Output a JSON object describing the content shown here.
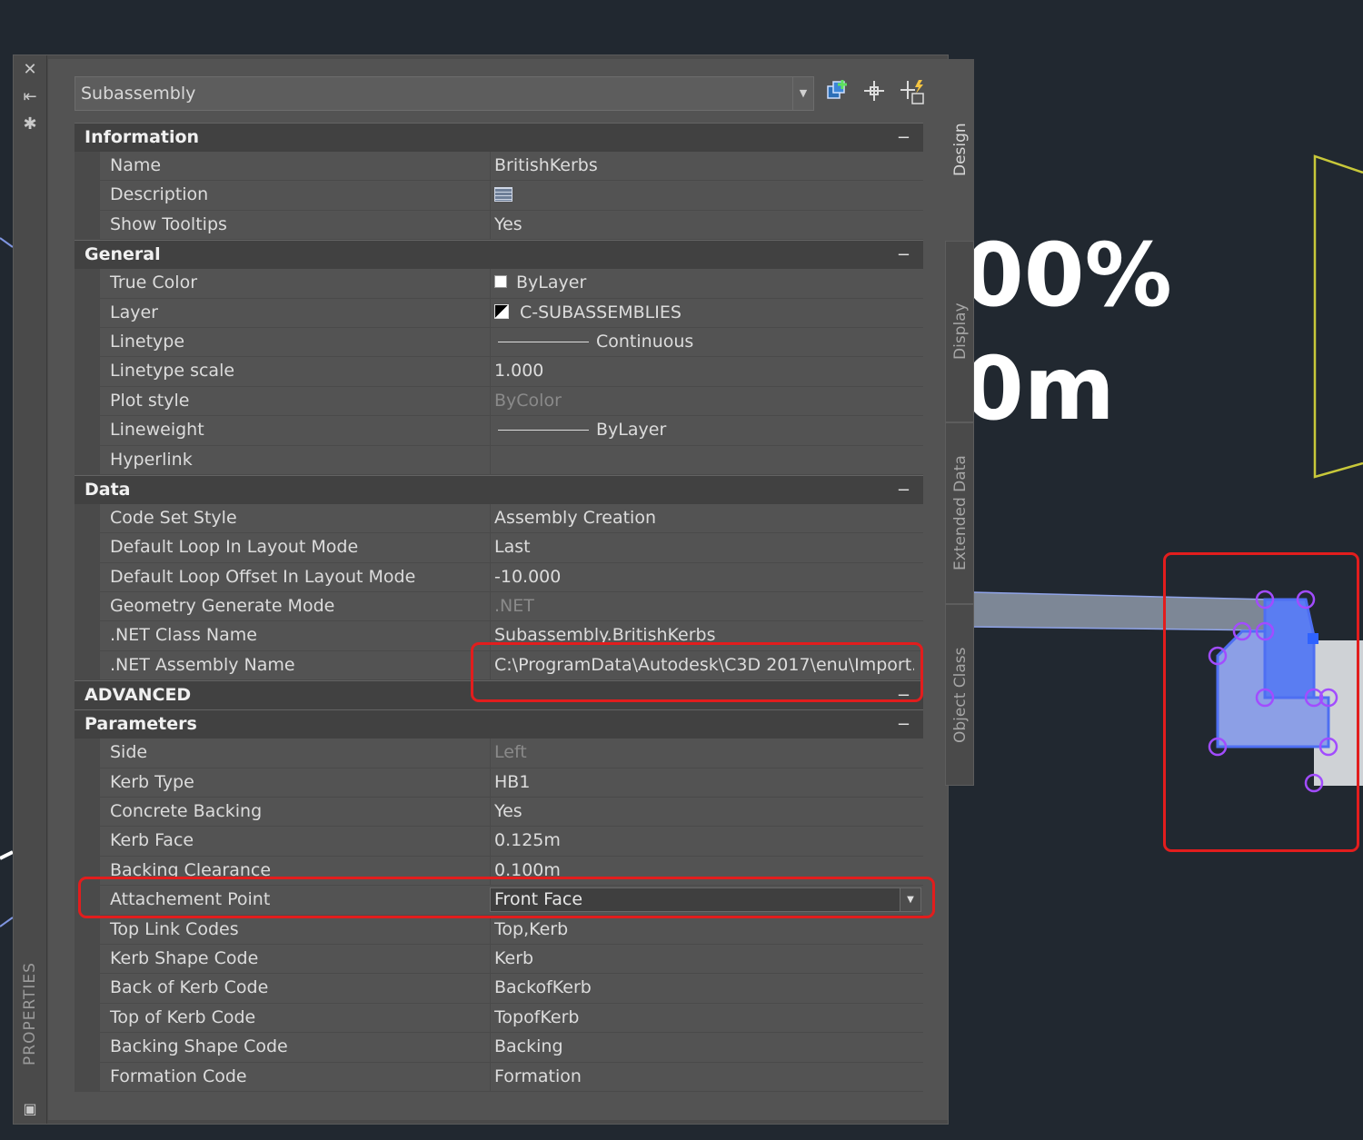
{
  "canvas": {
    "percent_text": "00%",
    "length_text": "0m"
  },
  "palette": {
    "title": "PROPERTIES",
    "selector": {
      "value": "Subassembly"
    },
    "tabs": [
      "Design",
      "Display",
      "Extended Data",
      "Object Class"
    ]
  },
  "information": {
    "title": "Information",
    "toggle": "−",
    "rows": [
      {
        "label": "Name",
        "value": "BritishKerbs"
      },
      {
        "label": "Description",
        "value": ""
      },
      {
        "label": "Show Tooltips",
        "value": "Yes"
      }
    ]
  },
  "general": {
    "title": "General",
    "toggle": "−",
    "rows": [
      {
        "label": "True Color",
        "value": "ByLayer"
      },
      {
        "label": "Layer",
        "value": "C-SUBASSEMBLIES"
      },
      {
        "label": "Linetype",
        "value": "Continuous"
      },
      {
        "label": "Linetype scale",
        "value": "1.000"
      },
      {
        "label": "Plot style",
        "value": "ByColor"
      },
      {
        "label": "Lineweight",
        "value": "ByLayer"
      },
      {
        "label": "Hyperlink",
        "value": ""
      }
    ]
  },
  "data_section": {
    "title": "Data",
    "toggle": "−",
    "rows": [
      {
        "label": "Code Set Style",
        "value": "Assembly Creation"
      },
      {
        "label": "Default Loop In Layout Mode",
        "value": "Last"
      },
      {
        "label": "Default Loop Offset In Layout Mode",
        "value": "-10.000"
      },
      {
        "label": "Geometry Generate Mode",
        "value": ".NET"
      },
      {
        "label": ".NET Class Name",
        "value": "Subassembly.BritishKerbs"
      },
      {
        "label": ".NET Assembly Name",
        "value": "C:\\ProgramData\\Autodesk\\C3D  2017\\enu\\Import..."
      }
    ]
  },
  "advanced": {
    "title": "ADVANCED",
    "toggle": "−"
  },
  "parameters": {
    "title": "Parameters",
    "toggle": "−",
    "rows": [
      {
        "label": "Side",
        "value": "Left"
      },
      {
        "label": "Kerb Type",
        "value": "HB1"
      },
      {
        "label": "Concrete Backing",
        "value": "Yes"
      },
      {
        "label": "Kerb Face",
        "value": "0.125m"
      },
      {
        "label": "Backing Clearance",
        "value": "0.100m"
      },
      {
        "label": "Attachement Point",
        "value": "Front Face"
      },
      {
        "label": "Top Link Codes",
        "value": "Top,Kerb"
      },
      {
        "label": "Kerb Shape Code",
        "value": "Kerb"
      },
      {
        "label": "Back of Kerb Code",
        "value": "BackofKerb"
      },
      {
        "label": "Top of Kerb Code",
        "value": "TopofKerb"
      },
      {
        "label": "Backing Shape Code",
        "value": "Backing"
      },
      {
        "label": "Formation Code",
        "value": "Formation"
      }
    ]
  },
  "colors": {
    "background": "#212830",
    "highlight": "#e21d1d",
    "subassembly_fill": "#8c9fe6",
    "grip": "#a24cff",
    "guide_line": "#c8c83a"
  }
}
